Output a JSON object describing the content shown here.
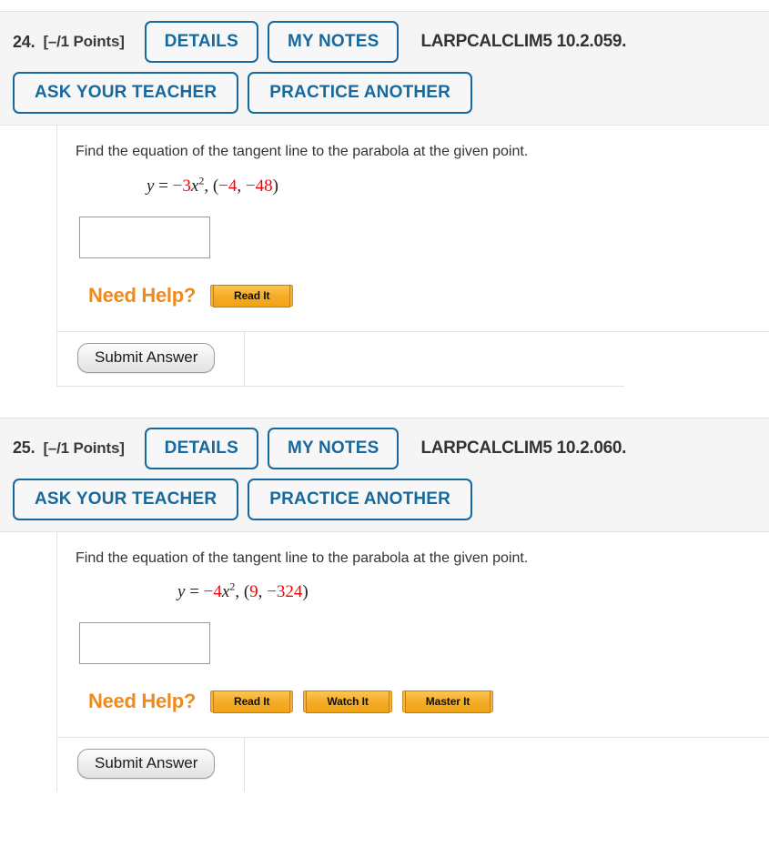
{
  "page": {
    "question_prompt": "Find the equation of the tangent line to the parabola at the given point.",
    "need_help_label": "Need Help?",
    "submit_label": "Submit Answer",
    "answer_placeholder": "",
    "colors": {
      "blue_accent": "#15699e",
      "orange_accent": "#f08a1c",
      "equation_red": "#fb0007",
      "header_band": "#f5f5f5"
    }
  },
  "problems": [
    {
      "number": "24.",
      "points": "[–/1 Points]",
      "textbook_ref": "LARPCALCLIM5 10.2.059.",
      "buttons_row1": [
        "DETAILS",
        "MY NOTES"
      ],
      "buttons_row2": [
        "ASK YOUR TEACHER",
        "PRACTICE ANOTHER"
      ],
      "prompt": "Find the equation of the tangent line to the parabola at the given point.",
      "equation": {
        "lhs": "y",
        "equals": "=",
        "coefficient": "−3",
        "variable": "x",
        "exponent": "2",
        "comma": ",",
        "point_open": "(",
        "point_x": "−4",
        "point_sep": ", ",
        "point_y": "−48",
        "point_close": ")"
      },
      "answer_value": "",
      "help_buttons": [
        "Read It"
      ],
      "submit_label": "Submit Answer"
    },
    {
      "number": "25.",
      "points": "[–/1 Points]",
      "textbook_ref": "LARPCALCLIM5 10.2.060.",
      "buttons_row1": [
        "DETAILS",
        "MY NOTES"
      ],
      "buttons_row2": [
        "ASK YOUR TEACHER",
        "PRACTICE ANOTHER"
      ],
      "prompt": "Find the equation of the tangent line to the parabola at the given point.",
      "equation": {
        "lhs": "y",
        "equals": "=",
        "coefficient": "−4",
        "variable": "x",
        "exponent": "2",
        "comma": ",",
        "point_open": "(",
        "point_x": "9",
        "point_sep": ", ",
        "point_y": "−324",
        "point_close": ")"
      },
      "answer_value": "",
      "help_buttons": [
        "Read It",
        "Watch It",
        "Master It"
      ],
      "submit_label": "Submit Answer"
    }
  ]
}
